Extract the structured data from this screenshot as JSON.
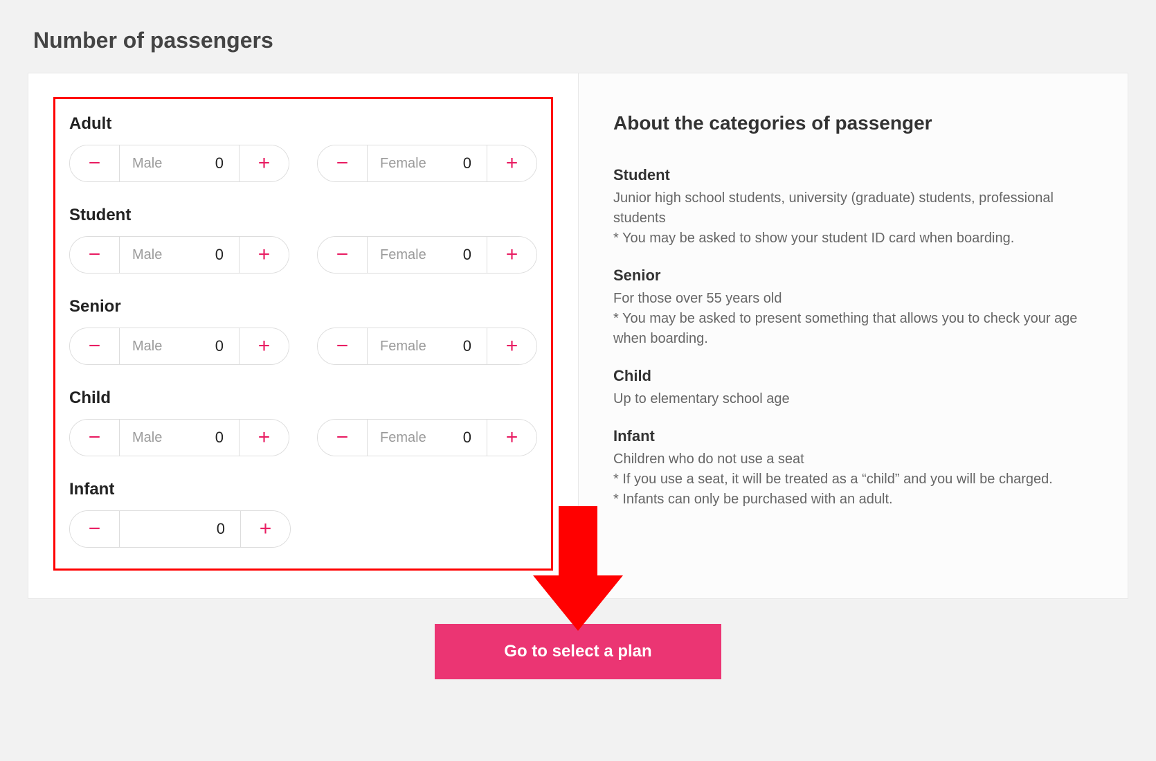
{
  "page": {
    "title": "Number of passengers"
  },
  "labels": {
    "male": "Male",
    "female": "Female"
  },
  "categories": {
    "adult": {
      "title": "Adult",
      "male": 0,
      "female": 0
    },
    "student": {
      "title": "Student",
      "male": 0,
      "female": 0
    },
    "senior": {
      "title": "Senior",
      "male": 0,
      "female": 0
    },
    "child": {
      "title": "Child",
      "male": 0,
      "female": 0
    },
    "infant": {
      "title": "Infant",
      "count": 0
    }
  },
  "about": {
    "title": "About the categories of passenger",
    "student": {
      "term": "Student",
      "desc": "Junior high school students, university (graduate) students, professional students\n* You may be asked to show your student ID card when boarding."
    },
    "senior": {
      "term": "Senior",
      "desc": "For those over 55 years old\n* You may be asked to present something that allows you to check your age when boarding."
    },
    "child": {
      "term": "Child",
      "desc": "Up to elementary school age"
    },
    "infant": {
      "term": "Infant",
      "desc": "Children who do not use a seat\n* If you use a seat, it will be treated as a “child” and you will be charged.\n* Infants can only be purchased with an adult."
    }
  },
  "cta": {
    "label": "Go to select a plan"
  },
  "colors": {
    "accent": "#eb3573",
    "highlight": "#ff0000"
  }
}
